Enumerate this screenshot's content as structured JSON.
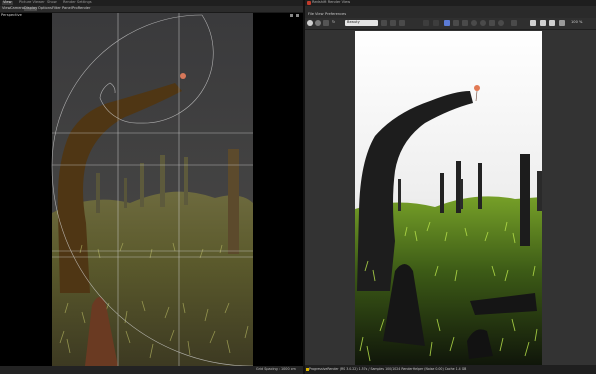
{
  "left_panel": {
    "tabs": [
      "View",
      "Picture Viewer",
      "Show",
      "Render Settings"
    ],
    "menu": [
      "View",
      "Cameras",
      "Display",
      "Options",
      "Filter",
      "Panel",
      "ProRender"
    ],
    "viewport_label": "Perspective",
    "grid_spacing": "Grid Spacing : 1000 cm"
  },
  "right_panel": {
    "title": "Redshift Render View",
    "menu": [
      "File",
      "View",
      "Preferences"
    ],
    "dropdown_value": "Beauty",
    "zoom": "100 %",
    "status": "ProgressiveRender (RS 3.0.22) 1.57s / Samples 100/1024 RenderHelper (Noise 0.00) Cache 1.4 GB"
  },
  "colors": {
    "toolbar_accent": "#5b7bd5",
    "status_dot": "#d9b400",
    "golden_overlay": "#d8d8d8"
  }
}
